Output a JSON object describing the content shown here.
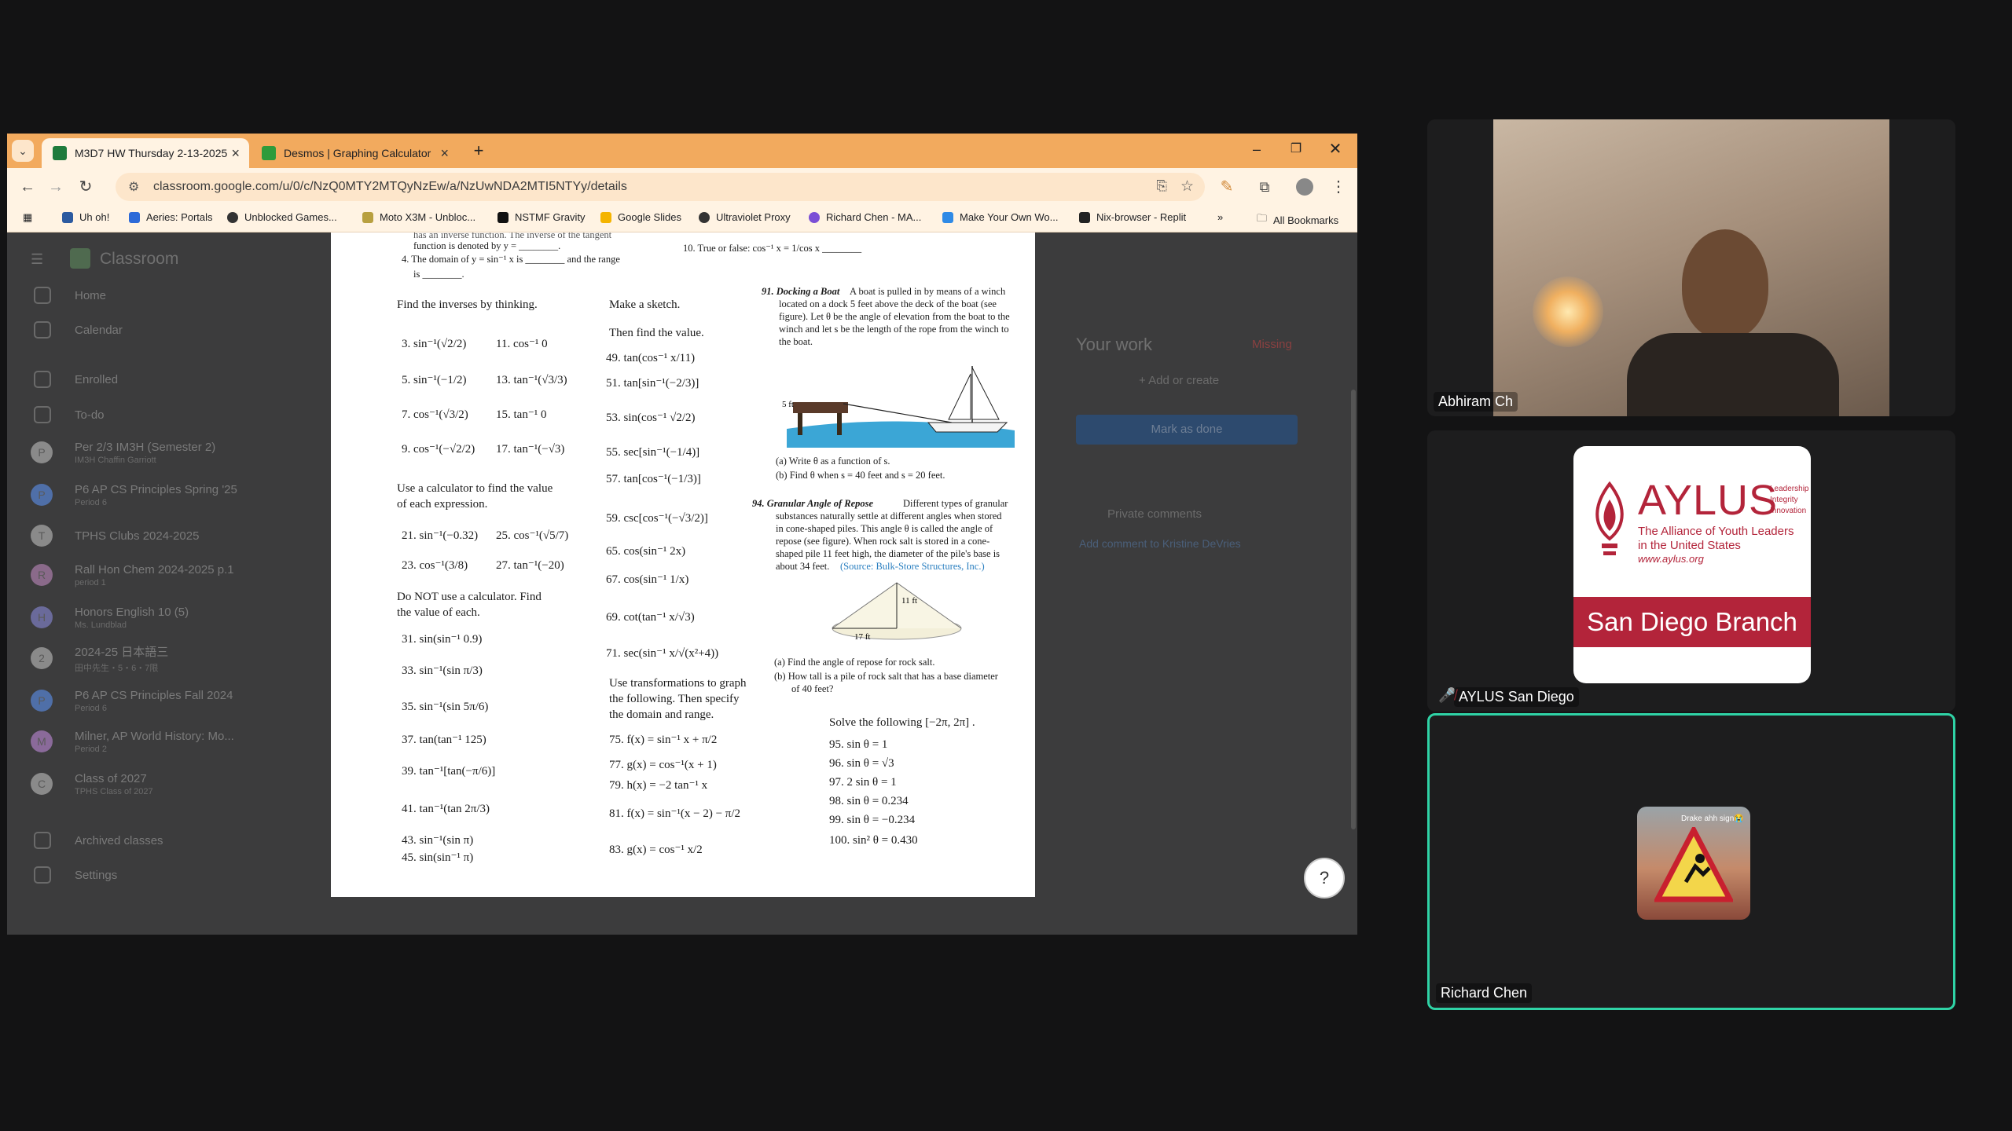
{
  "browser": {
    "tabs": [
      {
        "title": "M3D7 HW Thursday 2-13-2025",
        "active": true
      },
      {
        "title": "Desmos | Graphing Calculator",
        "active": false
      }
    ],
    "url": "classroom.google.com/u/0/c/NzQ0MTY2MTQyNzEw/a/NzUwNDA2MTI5NTYy/details",
    "bookmarks": [
      "Uh oh!",
      "Aeries: Portals",
      "Unblocked Games...",
      "Moto X3M - Unbloc...",
      "NSTMF Gravity",
      "Google Slides",
      "Ultraviolet Proxy",
      "Richard Chen - MA...",
      "Make Your Own Wo...",
      "Nix-browser - Replit",
      "All Bookmarks"
    ]
  },
  "classroom": {
    "header": "Classroom",
    "sidebar": [
      {
        "label": "Home",
        "type": "icon"
      },
      {
        "label": "Calendar",
        "type": "icon"
      },
      {
        "label": "Enrolled",
        "type": "icon"
      },
      {
        "label": "To-do",
        "type": "icon"
      },
      {
        "label": "Per 2/3 IM3H (Semester 2)",
        "sub": "IM3H Chaffin Garriott",
        "letter": "P",
        "color": "#8a8a8a"
      },
      {
        "label": "P6 AP CS Principles Spring '25",
        "sub": "Period 6",
        "letter": "P",
        "color": "#4f6fa8"
      },
      {
        "label": "TPHS Clubs 2024-2025",
        "sub": "",
        "letter": "T",
        "color": "#8a8a8a"
      },
      {
        "label": "Rall Hon Chem 2024-2025 p.1",
        "sub": "period 1",
        "letter": "R",
        "color": "#8a6a8a"
      },
      {
        "label": "Honors English 10 (5)",
        "sub": "Ms. Lundblad",
        "letter": "H",
        "color": "#6a6a9a"
      },
      {
        "label": "2024-25 日本語三",
        "sub": "田中先生・5・6・7限",
        "letter": "2",
        "color": "#8a8a8a"
      },
      {
        "label": "P6 AP CS Principles Fall 2024",
        "sub": "Period 6",
        "letter": "P",
        "color": "#4f6fa8"
      },
      {
        "label": "Milner, AP World History: Mo...",
        "sub": "Period 2",
        "letter": "M",
        "color": "#8a6a9a"
      },
      {
        "label": "Class of 2027",
        "sub": "TPHS Class of 2027",
        "letter": "C",
        "color": "#8a8a8a"
      },
      {
        "label": "Archived classes",
        "type": "icon"
      },
      {
        "label": "Settings",
        "type": "icon"
      }
    ],
    "your_work": "Your work",
    "missing": "Missing",
    "add_or_create": "+ Add or create",
    "mark_as_done": "Mark as done",
    "private_comments": "Private comments",
    "add_comment": "Add comment to Kristine DeVries"
  },
  "worksheet": {
    "top1": "has an inverse function. The inverse of the tangent",
    "top2": "function is denoted by y = ________.",
    "q4": "4.  The domain of y = sin⁻¹ x is ________ and the range",
    "q4b": "is ________.",
    "q10": "10.  True or false: cos⁻¹ x = 1/cos x ________",
    "h_inverses": "Find the inverses by thinking.",
    "h_sketch": "Make a sketch.",
    "h_value": "Then find the value.",
    "q3": "3.  sin⁻¹(√2/2)",
    "q11": "11.  cos⁻¹ 0",
    "q5": "5.  sin⁻¹(−1/2)",
    "q13": "13.  tan⁻¹(√3/3)",
    "q7": "7.  cos⁻¹(√3/2)",
    "q15": "15.  tan⁻¹ 0",
    "q9": "9.  cos⁻¹(−√2/2)",
    "q17": "17.  tan⁻¹(−√3)",
    "h_calc": "Use a calculator to find the value",
    "h_calc2": "of each expression.",
    "q21": "21.  sin⁻¹(−0.32)",
    "q25": "25.  cos⁻¹(√5/7)",
    "q23": "23.  cos⁻¹(3/8)",
    "q27": "27.  tan⁻¹(−20)",
    "h_nocalc": "Do NOT use a calculator.  Find",
    "h_nocalc2": "the value of each.",
    "q31": "31.  sin(sin⁻¹ 0.9)",
    "q33": "33.  sin⁻¹(sin π/3)",
    "q35": "35.  sin⁻¹(sin 5π/6)",
    "q37": "37.  tan(tan⁻¹ 125)",
    "q39": "39.  tan⁻¹[tan(−π/6)]",
    "q41": "41.  tan⁻¹(tan 2π/3)",
    "q43": "43.  sin⁻¹(sin π)",
    "q45": "45.  sin(sin⁻¹ π)",
    "q49": "49.  tan(cos⁻¹ x/11)",
    "q51": "51.  tan[sin⁻¹(−2/3)]",
    "q53": "53.  sin(cos⁻¹ √2/2)",
    "q55": "55.  sec[sin⁻¹(−1/4)]",
    "q57": "57.  tan[cos⁻¹(−1/3)]",
    "q59": "59.  csc[cos⁻¹(−√3/2)]",
    "q65": "65.  cos(sin⁻¹ 2x)",
    "q67": "67.  cos(sin⁻¹ 1/x)",
    "q69": "69.  cot(tan⁻¹ x/√3)",
    "q71": "71.  sec(sin⁻¹ x/√(x²+4))",
    "h_trans": "Use transformations to graph",
    "h_trans2": "the following.  Then specify",
    "h_trans3": "the domain and range.",
    "q75": "75.  f(x) = sin⁻¹ x + π/2",
    "q77": "77.  g(x) = cos⁻¹(x + 1)",
    "q79": "79.  h(x) = −2 tan⁻¹ x",
    "q81": "81.  f(x) = sin⁻¹(x − 2) − π/2",
    "q83": "83.  g(x) = cos⁻¹ x/2",
    "q91_title": "91.  Docking a Boat",
    "q91_l1": "A boat is pulled in by means of a winch",
    "q91_l2": "located on a dock 5 feet above the deck of the boat (see",
    "q91_l3": "figure). Let θ be the angle of elevation from the boat to the",
    "q91_l4": "winch and let s be the length of the rope from the winch to",
    "q91_l5": "the boat.",
    "q91_fig_label": "5 ft",
    "q91_a": "(a)  Write θ as a function of s.",
    "q91_b": "(b)  Find θ when s = 40 feet and s = 20 feet.",
    "q94_title": "94.  Granular Angle of Repose",
    "q94_l1": "Different types of granular",
    "q94_l2": "substances naturally settle at different angles when stored",
    "q94_l3": "in cone-shaped piles. This angle θ is called the angle of",
    "q94_l4": "repose (see figure). When rock salt is stored in a cone-",
    "q94_l5": "shaped pile 11 feet high, the diameter of the pile's base is",
    "q94_l6": "about 34 feet.",
    "q94_source": "(Source: Bulk-Store Structures, Inc.)",
    "q94_fig_h": "11 ft",
    "q94_fig_w": "17 ft",
    "q94_a": "(a)  Find the angle of repose for rock salt.",
    "q94_b": "(b)  How tall is a pile of rock salt that has a base diameter",
    "q94_b2": "of 40 feet?",
    "solve": "Solve  the following  [−2π, 2π] .",
    "q95": "95.  sin θ = 1",
    "q96": "96.  sin θ = √3",
    "q97": "97.  2 sin θ = 1",
    "q98": "98.  sin θ = 0.234",
    "q99": "99.  sin θ = −0.234",
    "q100": "100. sin² θ = 0.430"
  },
  "meeting": {
    "participants": [
      {
        "name": "Abhiram Ch"
      },
      {
        "name": "AYLUS San Diego",
        "muted": true
      },
      {
        "name": "Richard Chen",
        "active_speaker": true
      }
    ],
    "aylus": {
      "logo_text": "AYLUS",
      "tag1": "Leadership",
      "tag2": "Integrity",
      "tag3": "Innovation",
      "line1": "The Alliance of Youth Leaders",
      "line2": "in the United States",
      "url": "www.aylus.org",
      "branch": "San Diego Branch"
    },
    "richard_avatar_caption": "Drake ahh sign😭"
  }
}
